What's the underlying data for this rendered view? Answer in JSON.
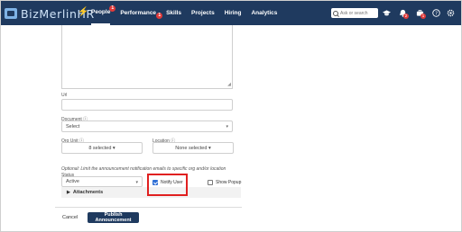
{
  "app": {
    "logo_text": "BizMerlinHR"
  },
  "nav": {
    "items": [
      {
        "label": "People",
        "badge": "1",
        "active": true
      },
      {
        "label": "Performance",
        "badge": "1"
      },
      {
        "label": "Skills"
      },
      {
        "label": "Projects"
      },
      {
        "label": "Hiring"
      },
      {
        "label": "Analytics"
      }
    ]
  },
  "search": {
    "placeholder": "Ask or search"
  },
  "toolbar": {
    "icons": [
      {
        "name": "graduation-cap-icon"
      },
      {
        "name": "bell-icon",
        "badge": "2"
      },
      {
        "name": "briefcase-icon",
        "badge": "1"
      },
      {
        "name": "help-icon"
      },
      {
        "name": "settings-icon"
      }
    ]
  },
  "form": {
    "url_label": "Url",
    "document_label": "Document ⓘ",
    "document_value": "Select",
    "org_unit_label": "Org Unit ⓘ",
    "org_unit_value": "8 selected ▾",
    "location_label": "Location ⓘ",
    "location_value": "None selected ▾",
    "hint": "Optional: Limit the announcement notification emails to specific org and/or location",
    "status_label": "Status",
    "status_value": "Active",
    "notify_user_label": "Notify User",
    "notify_user_checked": true,
    "show_popup_label": "Show Popup",
    "show_popup_checked": false,
    "attachments_label": "Attachments",
    "cancel_label": "Cancel",
    "publish_label": "Publish Announcement"
  },
  "colors": {
    "navbar": "#1f3a5f",
    "highlight": "#e02020",
    "badge": "#e03a3a"
  }
}
